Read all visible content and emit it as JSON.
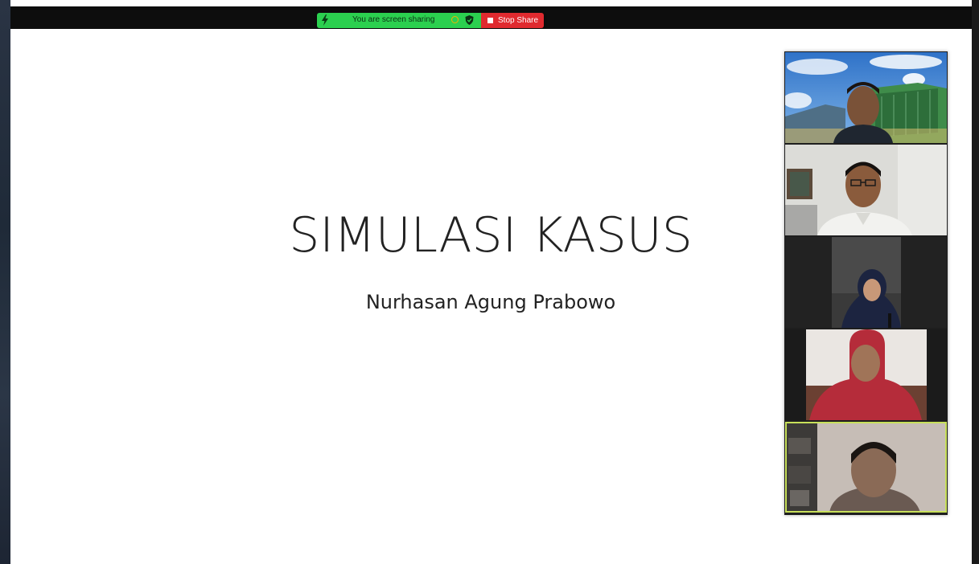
{
  "share_bar": {
    "status_text": "You are screen sharing",
    "stop_label": "Stop Share"
  },
  "slide": {
    "title": "SIMULASI KASUS",
    "subtitle": "Nurhasan Agung Prabowo"
  },
  "gallery": {
    "participants": [
      {
        "video": "outdoor-building-background"
      },
      {
        "video": "man-with-glasses-white-shirt"
      },
      {
        "video": "woman-navy-hijab-dark-room"
      },
      {
        "video": "woman-red-hijab"
      },
      {
        "video": "man-dim-room",
        "active_speaker": true
      }
    ]
  },
  "colors": {
    "share_green": "#2bd04f",
    "stop_red": "#e02a2f",
    "active_outline": "#c8e05a"
  },
  "icons": [
    "bolt-icon",
    "status-circle-icon",
    "shield-icon",
    "stop-square-icon"
  ]
}
